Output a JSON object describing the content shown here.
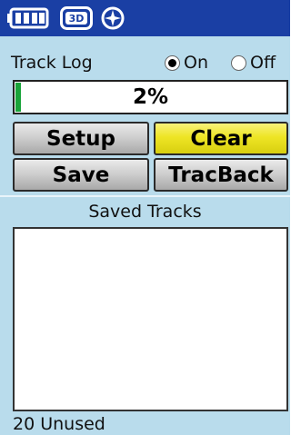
{
  "status_bar": {
    "icons": [
      "battery-icon",
      "gps-3d-icon",
      "compass-icon"
    ],
    "gps_mode": "3D",
    "background": "#1a3fa4"
  },
  "track_log": {
    "label": "Track Log",
    "options": [
      {
        "label": "On",
        "selected": true
      },
      {
        "label": "Off",
        "selected": false
      }
    ],
    "memory_used_percent": 2,
    "memory_used_text": "2%"
  },
  "buttons": {
    "setup": "Setup",
    "clear": "Clear",
    "save": "Save",
    "tracback": "TracBack"
  },
  "saved_tracks": {
    "title": "Saved Tracks",
    "items": [],
    "unused_text": "20 Unused"
  },
  "colors": {
    "background": "#b9dcec",
    "accent_yellow": "#eee525",
    "progress_green": "#19a43a"
  }
}
